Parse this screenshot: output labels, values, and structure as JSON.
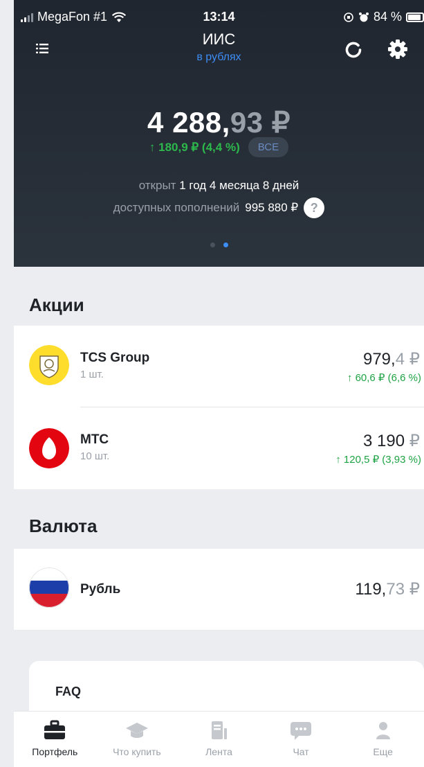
{
  "status_bar": {
    "carrier": "MegaFon #1",
    "time": "13:14",
    "battery": "84 %"
  },
  "header": {
    "title": "ИИС",
    "subtitle": "в рублях"
  },
  "summary": {
    "balance_int": "4 288,",
    "balance_frac": "93",
    "currency": "₽",
    "change": "↑ 180,9 ₽ (4,4 %)",
    "all_button": "ВСЕ",
    "opened_label": "открыт",
    "opened_value": "1 год 4 месяца 8 дней",
    "deposits_label": "доступных пополнений",
    "deposits_value": "995 880 ₽",
    "help_label": "?"
  },
  "sections": {
    "stocks_title": "Акции",
    "currency_title": "Валюта"
  },
  "stocks": [
    {
      "name": "TCS Group",
      "qty": "1 шт.",
      "price_int": "979,",
      "price_frac": "4",
      "currency": "₽",
      "delta": "↑ 60,6 ₽ (6,6 %)"
    },
    {
      "name": "МТС",
      "qty": "10 шт.",
      "price_int": "3 190",
      "price_frac": "",
      "currency": "₽",
      "delta": "↑ 120,5 ₽ (3,93 %)"
    }
  ],
  "currencies": [
    {
      "name": "Рубль",
      "price_int": "119,",
      "price_frac": "73",
      "currency": "₽"
    }
  ],
  "faq": {
    "title": "FAQ"
  },
  "tabs": [
    {
      "label": "Портфель",
      "icon": "briefcase-icon",
      "active": true
    },
    {
      "label": "Что купить",
      "icon": "graduation-cap-icon",
      "active": false
    },
    {
      "label": "Лента",
      "icon": "feed-icon",
      "active": false
    },
    {
      "label": "Чат",
      "icon": "chat-icon",
      "active": false
    },
    {
      "label": "Еще",
      "icon": "user-icon",
      "active": false
    }
  ],
  "colors": {
    "accent": "#3d8df5",
    "positive": "#1ea344",
    "header_bg": "#232a33"
  }
}
